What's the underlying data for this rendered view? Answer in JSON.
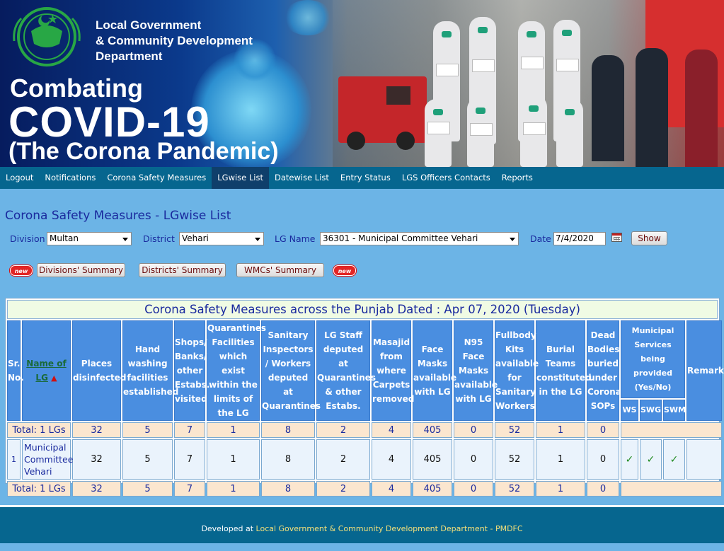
{
  "banner": {
    "org_line1": "Local Government",
    "org_line2": "& Community Development",
    "org_line3": "Department",
    "hero_line1": "Combating",
    "hero_line2": "COVID-19",
    "hero_line3": "(The Corona Pandemic)"
  },
  "nav": {
    "items": [
      {
        "label": "Logout"
      },
      {
        "label": "Notifications"
      },
      {
        "label": "Corona Safety Measures"
      },
      {
        "label": "LGwise List"
      },
      {
        "label": "Datewise List"
      },
      {
        "label": "Entry Status"
      },
      {
        "label": "LGS Officers Contacts"
      },
      {
        "label": "Reports"
      }
    ],
    "active_index": 3
  },
  "page": {
    "title": "Corona Safety Measures - LGwise List"
  },
  "filters": {
    "division_label": "Division",
    "division_value": "Multan",
    "district_label": "District",
    "district_value": "Vehari",
    "lg_label": "LG Name",
    "lg_value": "36301 - Municipal Committee Vehari",
    "date_label": "Date",
    "date_value": "7/4/2020",
    "show_button": "Show"
  },
  "summary_buttons": {
    "new_badge": "new",
    "divisions": "Divisions' Summary",
    "districts": "Districts' Summary",
    "wmcs": "WMCs' Summary"
  },
  "table": {
    "title": "Corona Safety Measures across the Punjab Dated : Apr 07, 2020 (Tuesday)",
    "headers": {
      "sr_no": "Sr. No.",
      "name_of_lg": "Name of LG",
      "places": "Places disinfected",
      "hand": "Hand washing facilities established",
      "shops": "Shops/ Banks/ other Estabs. visited",
      "quarantine": "Quarantines Facilities which exist within the limits of the LG",
      "sanitary": "Sanitary Inspectors / Workers deputed at Quarantines",
      "staff": "LG Staff deputed at Quarantines & other Estabs.",
      "masajid": "Masajid from where Carpets removed",
      "face": "Face Masks available with LG",
      "n95": "N95 Face Masks available with LG",
      "fullbody": "Fullbody Kits available for Sanitary Workers",
      "burial": "Burial Teams constituted in the LG",
      "dead": "Dead Bodies buried under Corona SOPs",
      "municipal": "Municipal Services being provided (Yes/No)",
      "ws": "WS",
      "swg": "SWG",
      "swm": "SWM",
      "remarks": "Remarks"
    },
    "total_top": {
      "label": "Total: 1 LGs",
      "values": [
        "32",
        "5",
        "7",
        "1",
        "8",
        "2",
        "4",
        "405",
        "0",
        "52",
        "1",
        "0"
      ]
    },
    "rows": [
      {
        "sr": "1",
        "name": "Municipal Committee Vehari",
        "values": [
          "32",
          "5",
          "7",
          "1",
          "8",
          "2",
          "4",
          "405",
          "0",
          "52",
          "1",
          "0"
        ],
        "ws": "✓",
        "swg": "✓",
        "swm": "✓",
        "remarks": ""
      }
    ],
    "total_bottom": {
      "label": "Total: 1 LGs",
      "values": [
        "32",
        "5",
        "7",
        "1",
        "8",
        "2",
        "4",
        "405",
        "0",
        "52",
        "1",
        "0"
      ]
    }
  },
  "footer": {
    "prefix": "Developed at",
    "org": "Local Government & Community Development Department - PMDFC"
  },
  "colors": {
    "page_bg": "#6cb4e6",
    "nav_bg": "#06668f",
    "nav_active": "#0f3f6b",
    "header_cell": "#4a8ee0",
    "total_row": "#fbe6cf",
    "title_text": "#1a2a9e"
  }
}
